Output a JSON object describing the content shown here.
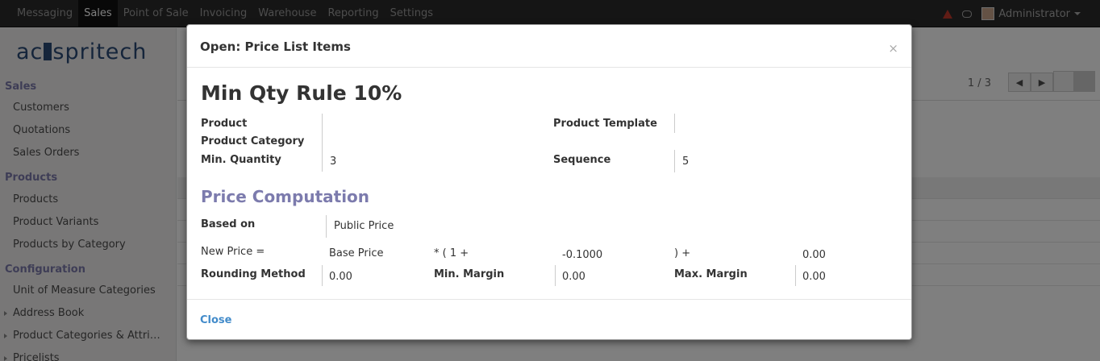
{
  "topmenu": [
    "Messaging",
    "Sales",
    "Point of Sale",
    "Invoicing",
    "Warehouse",
    "Reporting",
    "Settings"
  ],
  "active_menu": "Sales",
  "user": {
    "name": "Administrator"
  },
  "logo_text": {
    "left": "ac",
    "right": "spritech"
  },
  "sidebar": {
    "sales_header": "Sales",
    "sales_items": [
      "Customers",
      "Quotations",
      "Sales Orders"
    ],
    "products_header": "Products",
    "products_items": [
      "Products",
      "Product Variants",
      "Products by Category"
    ],
    "config_header": "Configuration",
    "config_items": [
      "Unit of Measure Categories",
      "Address Book",
      "Product Categories & Attri…",
      "Pricelists"
    ]
  },
  "pager": "1 / 3",
  "modal": {
    "title": "Open: Price List Items",
    "close_x": "×",
    "rule_name": "Min Qty Rule 10%",
    "labels": {
      "product": "Product",
      "product_template": "Product Template",
      "product_category": "Product Category",
      "min_quantity": "Min. Quantity",
      "sequence": "Sequence",
      "based_on": "Based on",
      "new_price": "New Price =",
      "rounding_method": "Rounding Method",
      "min_margin": "Min. Margin",
      "max_margin": "Max. Margin"
    },
    "values": {
      "min_quantity": "3",
      "sequence": "5",
      "based_on": "Public Price",
      "base_price": "Base Price",
      "mult_prefix": "* ( 1 +",
      "discount": "-0.1000",
      "plus_suffix": ") +",
      "surcharge": "0.00",
      "rounding": "0.00",
      "min_margin": "0.00",
      "max_margin": "0.00"
    },
    "section_title": "Price Computation",
    "close_button": "Close"
  }
}
